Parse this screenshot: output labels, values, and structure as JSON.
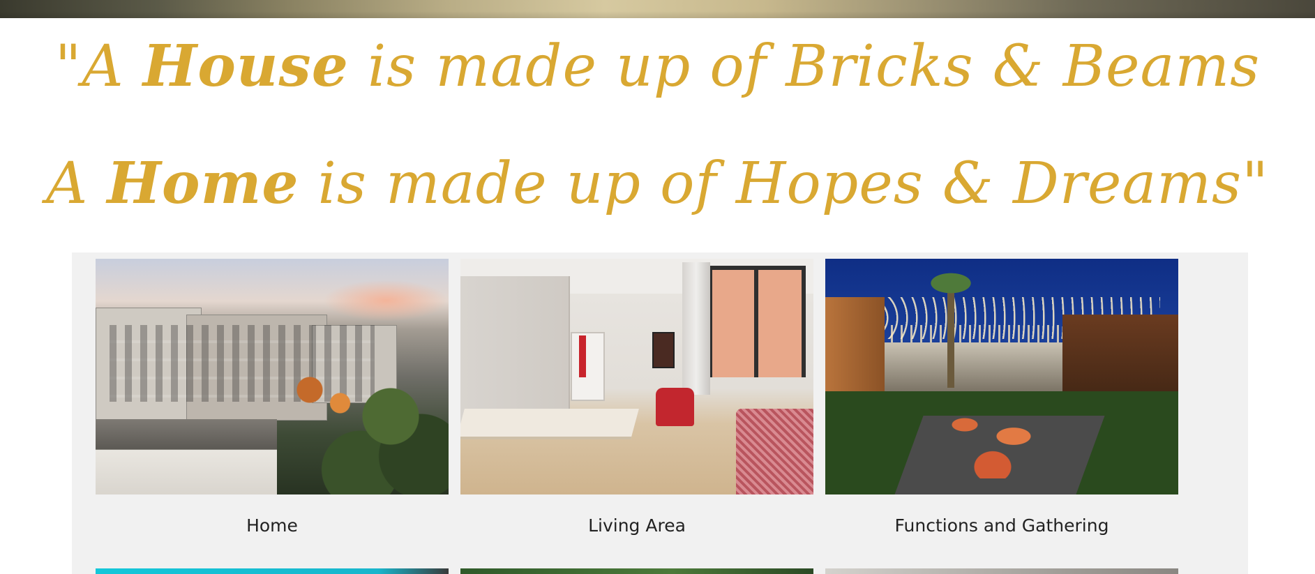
{
  "quote": {
    "line1_prefix": "\"A ",
    "line1_emphasis": "House",
    "line1_suffix": " is made up of Bricks & Beams",
    "line2_prefix": "A ",
    "line2_emphasis": "Home",
    "line2_suffix": " is made up of Hopes & Dreams\"",
    "color": "#d9a832"
  },
  "gallery": {
    "background": "#f1f1f1",
    "cards": [
      {
        "caption": "Home"
      },
      {
        "caption": "Living Area"
      },
      {
        "caption": "Functions and Gathering"
      }
    ]
  }
}
